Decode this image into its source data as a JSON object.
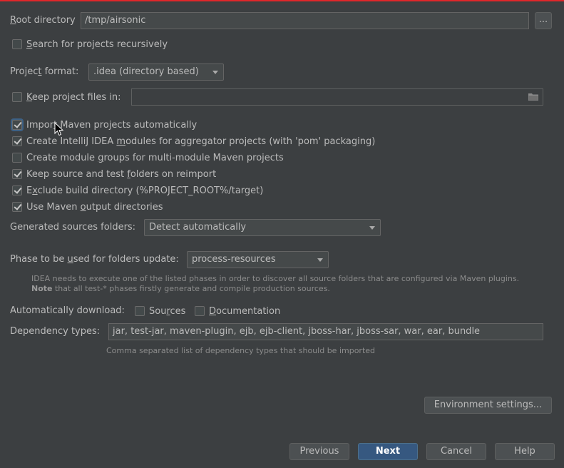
{
  "root_dir": {
    "label_first": "R",
    "label_rest": "oot directory",
    "value": "/tmp/airsonic",
    "browse_label": "..."
  },
  "search_recursive": {
    "label_first": "S",
    "label_rest": "earch for projects recursively",
    "checked": false
  },
  "project_format": {
    "label_pre": "Projec",
    "label_u": "t",
    "label_post": " format:",
    "value": ".idea (directory based)"
  },
  "keep_files": {
    "label_first": "K",
    "label_rest": "eep project files in:",
    "value": ""
  },
  "options": [
    {
      "pre": "Impor",
      "u": "t",
      "post": " Maven projects automatically",
      "checked": true
    },
    {
      "pre": "Create IntelliJ IDEA ",
      "u": "m",
      "post": "odules for aggregator projects (with 'pom' packaging)",
      "checked": true
    },
    {
      "pre": "Create module ",
      "u": "g",
      "post": "roups for multi-module Maven projects",
      "checked": false
    },
    {
      "pre": "Keep source and test ",
      "u": "f",
      "post": "olders on reimport",
      "checked": true
    },
    {
      "pre": "E",
      "u": "x",
      "post": "clude build directory (%PROJECT_ROOT%/target)",
      "checked": true
    },
    {
      "pre": "Use Maven ",
      "u": "o",
      "post": "utput directories",
      "checked": true
    }
  ],
  "generated_sources": {
    "label": "Generated sources folders:",
    "value": "Detect automatically"
  },
  "phase": {
    "label_pre": "Phase to be ",
    "label_u": "u",
    "label_post": "sed for folders update:",
    "value": "process-resources"
  },
  "phase_hint": {
    "line1": "IDEA needs to execute one of the listed phases in order to discover all source folders that are configured via Maven plugins.",
    "line2_bold": "Note",
    "line2_rest": " that all test-* phases firstly generate and compile production sources."
  },
  "auto_download": {
    "label": "Automatically download:",
    "sources_pre": "Sou",
    "sources_u": "r",
    "sources_post": "ces",
    "docs_u": "D",
    "docs_post": "ocumentation",
    "sources_checked": false,
    "docs_checked": false
  },
  "dependency_types": {
    "label": "Dependency types:",
    "value": "jar, test-jar, maven-plugin, ejb, ejb-client, jboss-har, jboss-sar, war, ear, bundle",
    "hint": "Comma separated list of dependency types that should be imported"
  },
  "buttons": {
    "env": "Environment settings...",
    "previous": "Previous",
    "next": "Next",
    "cancel": "Cancel",
    "help": "Help"
  },
  "colors": {
    "background": "#3c3f41",
    "accent": "#365880",
    "top_border": "#e0262a"
  }
}
